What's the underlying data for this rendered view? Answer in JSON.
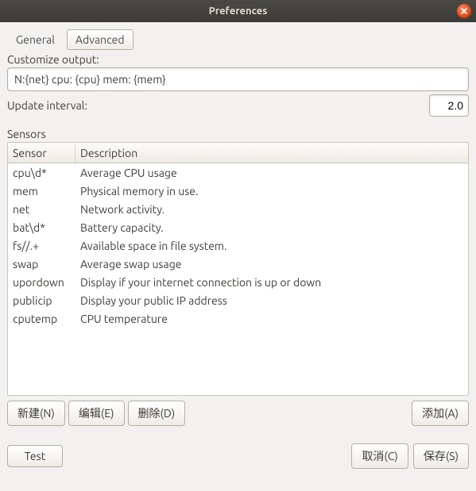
{
  "window": {
    "title": "Preferences"
  },
  "tabs": {
    "general": "General",
    "advanced": "Advanced"
  },
  "customize": {
    "label": "Customize output:",
    "value": "N:{net} cpu: {cpu} mem: {mem}"
  },
  "interval": {
    "label": "Update interval:",
    "value": "2.0"
  },
  "sensors": {
    "title": "Sensors",
    "headers": {
      "sensor": "Sensor",
      "description": "Description"
    },
    "rows": [
      {
        "sensor": "cpu\\d*",
        "description": "Average CPU usage"
      },
      {
        "sensor": "mem",
        "description": "Physical memory in use."
      },
      {
        "sensor": "net",
        "description": "Network activity."
      },
      {
        "sensor": "bat\\d*",
        "description": "Battery capacity."
      },
      {
        "sensor": "fs//.+",
        "description": "Available space in file system."
      },
      {
        "sensor": "swap",
        "description": "Average swap usage"
      },
      {
        "sensor": "upordown",
        "description": "Display if your internet connection is up or down"
      },
      {
        "sensor": "publicip",
        "description": "Display your public IP address"
      },
      {
        "sensor": "cputemp",
        "description": "CPU temperature"
      }
    ]
  },
  "buttons": {
    "new": "新建(N)",
    "edit": "编辑(E)",
    "delete": "删除(D)",
    "add": "添加(A)",
    "test": "Test",
    "cancel": "取消(C)",
    "save": "保存(S)"
  }
}
